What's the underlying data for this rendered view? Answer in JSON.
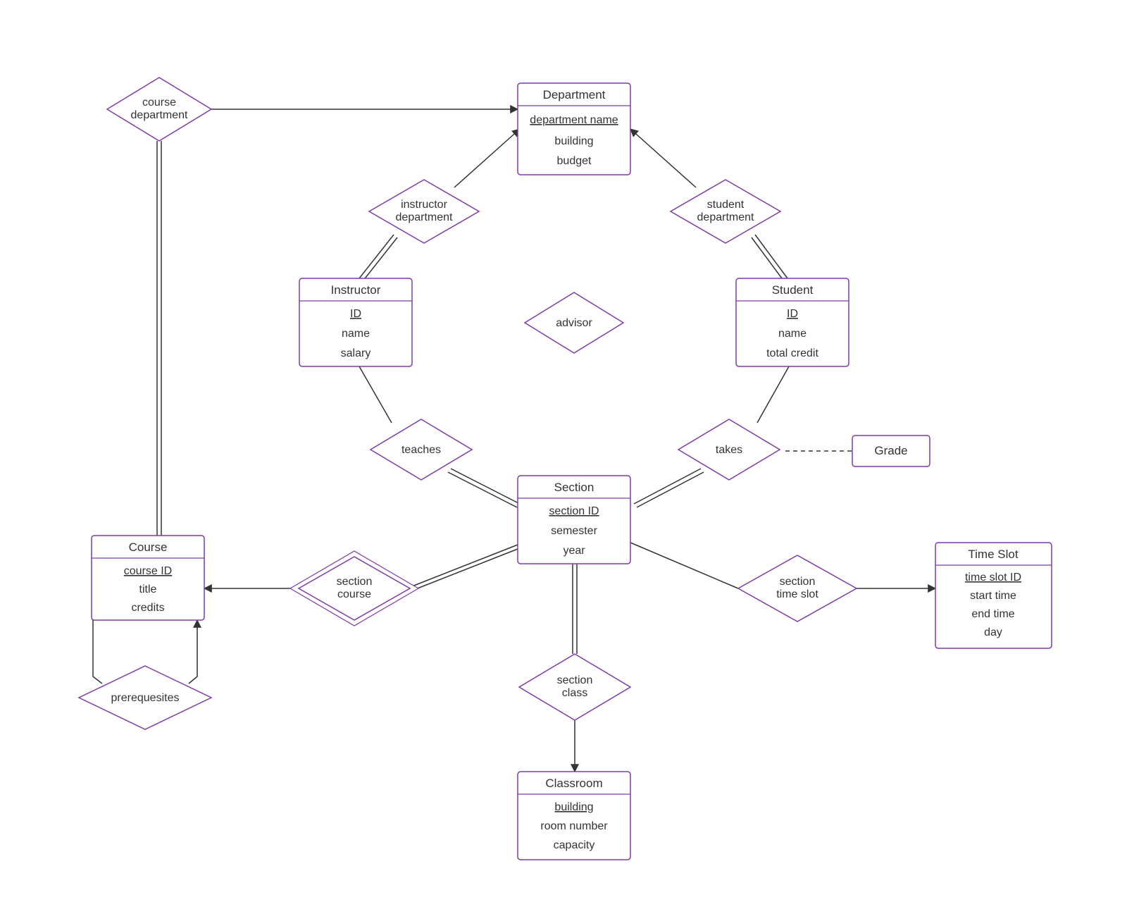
{
  "entities": {
    "department": {
      "title": "Department",
      "key": "department name",
      "attrs": [
        "building",
        "budget"
      ]
    },
    "instructor": {
      "title": "Instructor",
      "key": "ID",
      "attrs": [
        "name",
        "salary"
      ]
    },
    "student": {
      "title": "Student",
      "key": "ID",
      "attrs": [
        "name",
        "total credit"
      ]
    },
    "section": {
      "title": "Section",
      "key": "section ID",
      "attrs": [
        "semester",
        "year"
      ]
    },
    "course": {
      "title": "Course",
      "key": "course ID",
      "attrs": [
        "title",
        "credits"
      ]
    },
    "classroom": {
      "title": "Classroom",
      "key": "building",
      "attrs": [
        "room number",
        "capacity"
      ]
    },
    "timeslot": {
      "title": "Time Slot",
      "key": "time slot ID",
      "attrs": [
        "start time",
        "end time",
        "day"
      ]
    },
    "grade": {
      "title": "Grade"
    }
  },
  "relationships": {
    "course_department": {
      "l1": "course",
      "l2": "department"
    },
    "instructor_department": {
      "l1": "instructor",
      "l2": "department"
    },
    "student_department": {
      "l1": "student",
      "l2": "department"
    },
    "advisor": {
      "l1": "advisor"
    },
    "teaches": {
      "l1": "teaches"
    },
    "takes": {
      "l1": "takes"
    },
    "section_course": {
      "l1": "section",
      "l2": "course"
    },
    "section_class": {
      "l1": "section",
      "l2": "class"
    },
    "section_timeslot": {
      "l1": "section",
      "l2": "time slot"
    },
    "prerequisites": {
      "l1": "prerequesites"
    }
  }
}
